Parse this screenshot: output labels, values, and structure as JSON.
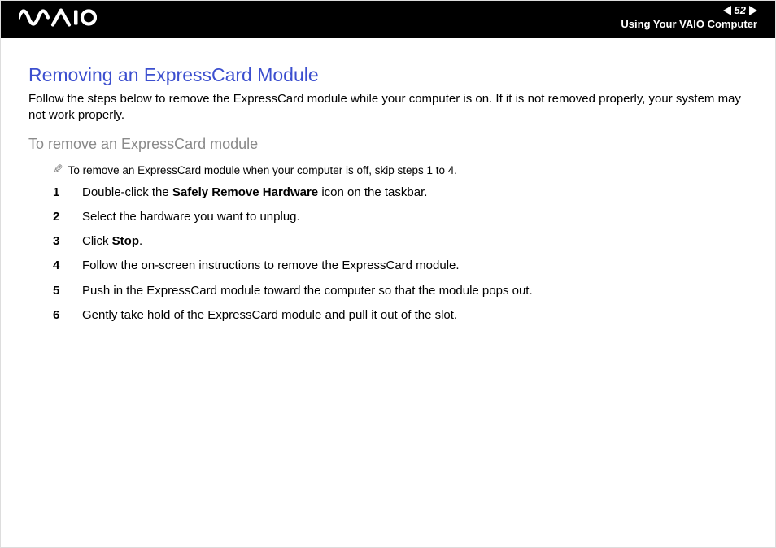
{
  "header": {
    "page_number": "52",
    "section": "Using Your VAIO Computer"
  },
  "main": {
    "title": "Removing an ExpressCard Module",
    "intro": "Follow the steps below to remove the ExpressCard module while your computer is on. If it is not removed properly, your system may not work properly.",
    "subheading": "To remove an ExpressCard module",
    "note": "To remove an ExpressCard module when your computer is off, skip steps 1 to 4.",
    "steps": [
      {
        "n": "1",
        "pre": "Double-click the ",
        "bold": "Safely Remove Hardware",
        "post": " icon on the taskbar."
      },
      {
        "n": "2",
        "pre": "Select the hardware you want to unplug.",
        "bold": "",
        "post": ""
      },
      {
        "n": "3",
        "pre": "Click ",
        "bold": "Stop",
        "post": "."
      },
      {
        "n": "4",
        "pre": "Follow the on-screen instructions to remove the ExpressCard module.",
        "bold": "",
        "post": ""
      },
      {
        "n": "5",
        "pre": "Push in the ExpressCard module toward the computer so that the module pops out.",
        "bold": "",
        "post": ""
      },
      {
        "n": "6",
        "pre": "Gently take hold of the ExpressCard module and pull it out of the slot.",
        "bold": "",
        "post": ""
      }
    ]
  }
}
